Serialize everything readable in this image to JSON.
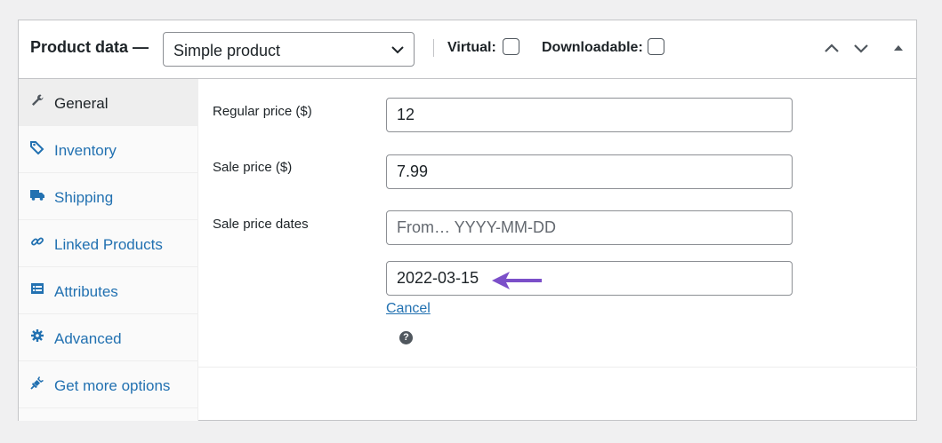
{
  "header": {
    "title": "Product data —",
    "product_type": "Simple product",
    "virtual_label": "Virtual:",
    "downloadable_label": "Downloadable:",
    "virtual_checked": false,
    "downloadable_checked": false
  },
  "tabs": [
    {
      "label": "General",
      "icon": "wrench-icon",
      "active": true
    },
    {
      "label": "Inventory",
      "icon": "tag-icon",
      "active": false
    },
    {
      "label": "Shipping",
      "icon": "truck-icon",
      "active": false
    },
    {
      "label": "Linked Products",
      "icon": "link-icon",
      "active": false
    },
    {
      "label": "Attributes",
      "icon": "list-icon",
      "active": false
    },
    {
      "label": "Advanced",
      "icon": "gear-icon",
      "active": false
    },
    {
      "label": "Get more options",
      "icon": "plug-icon",
      "active": false
    }
  ],
  "general": {
    "regular_price_label": "Regular price ($)",
    "regular_price_value": "12",
    "sale_price_label": "Sale price ($)",
    "sale_price_value": "7.99",
    "sale_dates_label": "Sale price dates",
    "from_placeholder": "From… YYYY-MM-DD",
    "to_value": "2022-03-15",
    "cancel_label": "Cancel",
    "help_glyph": "?"
  },
  "colors": {
    "link": "#2271b1",
    "annotation_arrow": "#7b4fc9"
  }
}
